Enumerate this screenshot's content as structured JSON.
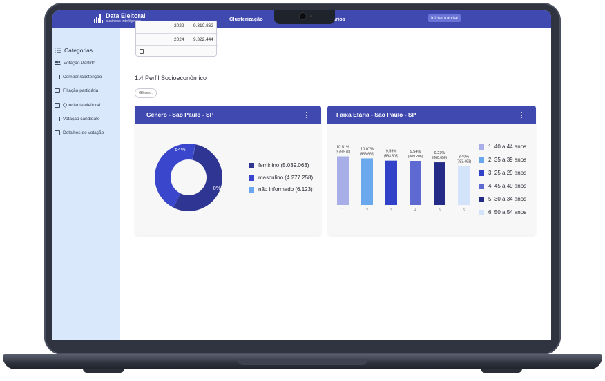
{
  "topbar": {
    "brand_title": "Data Eleitoral",
    "brand_subtitle": "business intelligence",
    "nav": [
      "Clusterização",
      "ários"
    ],
    "tour_button": "Iniciar tutorial"
  },
  "sidebar": {
    "heading": "Categorias",
    "items": [
      {
        "label": "Votação Partido",
        "icon": "people-icon"
      },
      {
        "label": "Compar./abstenção",
        "icon": "calendar-icon"
      },
      {
        "label": "Filiação partidária",
        "icon": "id-card-icon"
      },
      {
        "label": "Quociente eleitoral",
        "icon": "calculator-icon"
      },
      {
        "label": "Votação candidato",
        "icon": "ballot-icon"
      },
      {
        "label": "Detalhes de votação",
        "icon": "table-icon"
      }
    ]
  },
  "table_fragment": {
    "rows": [
      {
        "year": "2022",
        "value": "9.310.862"
      },
      {
        "year": "2024",
        "value": "9.322.444"
      }
    ]
  },
  "section": {
    "title": "1.4 Perfil Socioeconômico",
    "filter_chip": "Gênero:"
  },
  "colors": {
    "accent": "#3f49b0",
    "sidebar_bg": "#d9e8fb"
  },
  "gender_card": {
    "title": "Gênero - São Paulo - SP",
    "chart_data": {
      "type": "pie",
      "donut": true,
      "slices": [
        {
          "label": "feminino (5.039.063)",
          "value": 5039063,
          "percent_label": "54%",
          "color": "#2e3592"
        },
        {
          "label": "masculino (4.277.258)",
          "value": 4277258,
          "percent_label": "46%",
          "color": "#3a47cc"
        },
        {
          "label": "não informado (6.123)",
          "value": 6123,
          "percent_label": "0%",
          "color": "#6ba7ee"
        }
      ]
    }
  },
  "age_card": {
    "title": "Faixa Etária - São Paulo - SP",
    "chart_data": {
      "type": "bar",
      "categories": [
        "1",
        "2",
        "3",
        "4",
        "5",
        "6"
      ],
      "values": [
        10.51,
        10.07,
        9.59,
        9.54,
        9.23,
        8.4
      ],
      "data_labels": [
        [
          "10.51%",
          "(979.570)"
        ],
        [
          "10.07%",
          "(938.666)"
        ],
        [
          "9.59%",
          "(893.803)"
        ],
        [
          "9.54%",
          "(889.208)"
        ],
        [
          "9.23%",
          "(860.656)"
        ],
        [
          "8.40%",
          "(783.463)"
        ]
      ],
      "colors": [
        "#a8afe8",
        "#6aa8ee",
        "#3142c8",
        "#5e6ad2",
        "#232b86",
        "#d3e4fa"
      ],
      "legend": [
        "1. 40 a 44 anos",
        "2. 35 a 39 anos",
        "3. 25 a 29 anos",
        "4. 45 a 49 anos",
        "5. 30 a 34 anos",
        "6. 50 a 54 anos"
      ],
      "ylim": [
        0,
        12
      ]
    }
  }
}
